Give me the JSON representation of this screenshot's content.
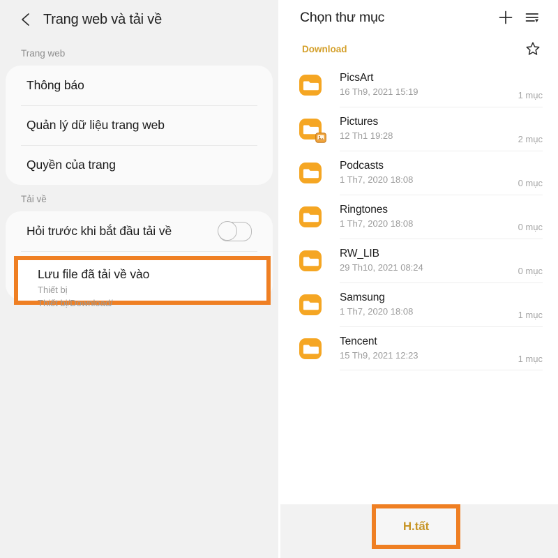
{
  "left": {
    "header": {
      "back_icon": "chevron-left-icon",
      "title": "Trang web và tải về"
    },
    "sections": [
      {
        "label": "Trang web",
        "rows": [
          {
            "label": "Thông báo"
          },
          {
            "label": "Quản lý dữ liệu trang web"
          },
          {
            "label": "Quyền của trang"
          }
        ]
      },
      {
        "label": "Tải về",
        "rows": [
          {
            "label": "Hỏi trước khi bắt đầu tải về",
            "toggle": "off"
          }
        ]
      }
    ],
    "highlighted_row": {
      "title": "Lưu file đã tải về vào",
      "sub1": "Thiết bị",
      "sub2": "Thiết bị/Download/",
      "highlight_color": "#ef7f23"
    }
  },
  "right": {
    "header": {
      "title": "Chọn thư mục",
      "add_icon": "plus-icon",
      "sort_icon": "sort-list-icon"
    },
    "breadcrumb": {
      "current": "Download",
      "star_icon": "star-outline-icon",
      "color": "#d4a02b"
    },
    "files": [
      {
        "name": "PicsArt",
        "date": "16 Th9, 2021 15:19",
        "count": "1 mục",
        "icon": "folder-icon",
        "badge": null
      },
      {
        "name": "Pictures",
        "date": "12 Th1 19:28",
        "count": "2 mục",
        "icon": "folder-icon",
        "badge": "image-badge-icon"
      },
      {
        "name": "Podcasts",
        "date": "1 Th7, 2020 18:08",
        "count": "0 mục",
        "icon": "folder-icon",
        "badge": null
      },
      {
        "name": "Ringtones",
        "date": "1 Th7, 2020 18:08",
        "count": "0 mục",
        "icon": "folder-icon",
        "badge": null
      },
      {
        "name": "RW_LIB",
        "date": "29 Th10, 2021 08:24",
        "count": "0 mục",
        "icon": "folder-icon",
        "badge": null
      },
      {
        "name": "Samsung",
        "date": "1 Th7, 2020 18:08",
        "count": "1 mục",
        "icon": "folder-icon",
        "badge": null
      },
      {
        "name": "Tencent",
        "date": "15 Th9, 2021 12:23",
        "count": "1 mục",
        "icon": "folder-icon",
        "badge": null
      }
    ],
    "bottom": {
      "done_label": "H.tất",
      "highlight_color": "#ef7f23"
    }
  },
  "colors": {
    "folder_orange": "#f5a623",
    "highlight_orange": "#ef7f23",
    "accent_gold": "#d4a02b"
  }
}
